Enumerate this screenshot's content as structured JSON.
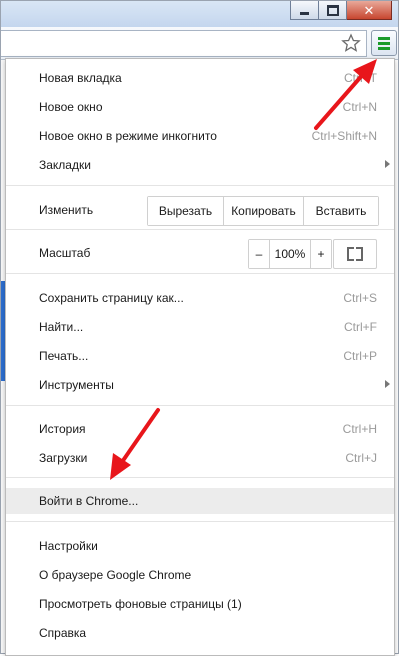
{
  "window": {
    "close_glyph": "✕"
  },
  "toolbar": {
    "star_icon": "star-icon",
    "menu_icon": "hamburger-menu-icon"
  },
  "menu": {
    "group1": [
      {
        "id": "new-tab",
        "label": "Новая вкладка",
        "shortcut": "Ctrl+T"
      },
      {
        "id": "new-window",
        "label": "Новое окно",
        "shortcut": "Ctrl+N"
      },
      {
        "id": "incognito",
        "label": "Новое окно в режиме инкогнито",
        "shortcut": "Ctrl+Shift+N"
      },
      {
        "id": "bookmarks",
        "label": "Закладки",
        "submenu": true
      }
    ],
    "edit": {
      "label": "Изменить",
      "cut": "Вырезать",
      "copy": "Копировать",
      "paste": "Вставить"
    },
    "zoom": {
      "label": "Масштаб",
      "minus": "–",
      "value": "100%",
      "plus": "+"
    },
    "group2": [
      {
        "id": "save-page",
        "label": "Сохранить страницу как...",
        "shortcut": "Ctrl+S"
      },
      {
        "id": "find",
        "label": "Найти...",
        "shortcut": "Ctrl+F"
      },
      {
        "id": "print",
        "label": "Печать...",
        "shortcut": "Ctrl+P"
      },
      {
        "id": "tools",
        "label": "Инструменты",
        "submenu": true
      }
    ],
    "group3": [
      {
        "id": "history",
        "label": "История",
        "shortcut": "Ctrl+H"
      },
      {
        "id": "downloads",
        "label": "Загрузки",
        "shortcut": "Ctrl+J"
      }
    ],
    "signin": {
      "label": "Войти в Chrome..."
    },
    "group4": [
      {
        "id": "settings",
        "label": "Настройки"
      },
      {
        "id": "about",
        "label": "О браузере Google Chrome"
      },
      {
        "id": "background-pages",
        "label": "Просмотреть фоновые страницы (1)"
      },
      {
        "id": "help",
        "label": "Справка"
      }
    ]
  },
  "colors": {
    "arrow": "#e8161b",
    "menu_icon": "#1a9a2a",
    "hover": "#ececec"
  }
}
